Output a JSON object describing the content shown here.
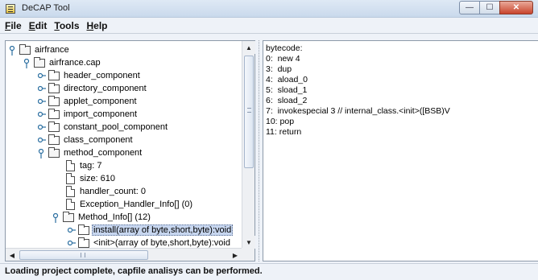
{
  "window": {
    "title": "DeCAP Tool"
  },
  "window_controls": {
    "minimize": "—",
    "maximize": "☐",
    "close": "✕"
  },
  "menu": {
    "items": [
      {
        "label": "File"
      },
      {
        "label": "Edit"
      },
      {
        "label": "Tools"
      },
      {
        "label": "Help"
      }
    ]
  },
  "tree": {
    "nodes": [
      {
        "label": "airfrance",
        "icon": "folder-icon",
        "expander": "expanded"
      },
      {
        "label": "airfrance.cap",
        "icon": "folder-icon",
        "expander": "expanded"
      },
      {
        "label": "header_component",
        "icon": "folder-icon",
        "expander": "collapsed"
      },
      {
        "label": "directory_component",
        "icon": "folder-icon",
        "expander": "collapsed"
      },
      {
        "label": "applet_component",
        "icon": "folder-icon",
        "expander": "collapsed"
      },
      {
        "label": "import_component",
        "icon": "folder-icon",
        "expander": "collapsed"
      },
      {
        "label": "constant_pool_component",
        "icon": "folder-icon",
        "expander": "collapsed"
      },
      {
        "label": "class_component",
        "icon": "folder-icon",
        "expander": "collapsed"
      },
      {
        "label": "method_component",
        "icon": "folder-icon",
        "expander": "expanded"
      },
      {
        "label": "tag: 7",
        "icon": "document-icon",
        "expander": "none"
      },
      {
        "label": "size: 610",
        "icon": "document-icon",
        "expander": "none"
      },
      {
        "label": "handler_count: 0",
        "icon": "document-icon",
        "expander": "none"
      },
      {
        "label": "Exception_Handler_Info[] (0)",
        "icon": "document-icon",
        "expander": "none"
      },
      {
        "label": "Method_Info[] (12)",
        "icon": "folder-icon",
        "expander": "expanded"
      },
      {
        "label": "install(array of byte,short,byte):void",
        "icon": "folder-icon",
        "expander": "collapsed",
        "selected": true
      },
      {
        "label": "<init>(array of byte,short,byte):void",
        "icon": "folder-icon",
        "expander": "collapsed"
      }
    ]
  },
  "bytecode": {
    "lines": [
      "bytecode:",
      "0:  new 4",
      "3:  dup",
      "4:  aload_0",
      "5:  sload_1",
      "6:  sload_2",
      "7:  invokespecial 3 // internal_class.<init>([BSB)V",
      "10: pop",
      "11: return"
    ]
  },
  "status": {
    "text": "Loading project complete, capfile analisys can be performed."
  }
}
